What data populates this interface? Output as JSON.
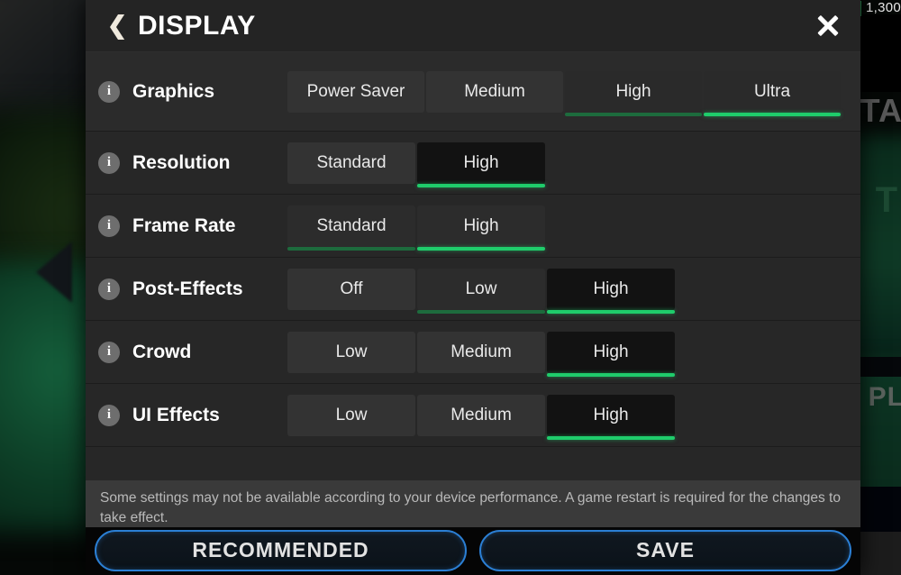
{
  "background": {
    "hud_count": "1,300",
    "text_fragments": [
      "TA",
      "T",
      "PL"
    ]
  },
  "header": {
    "back_icon": "chevron-left-icon",
    "title": "DISPLAY",
    "close_icon": "close-icon"
  },
  "settings": [
    {
      "label": "Graphics",
      "info_icon": "info-icon",
      "options": [
        {
          "label": "Power Saver",
          "state": "unselected"
        },
        {
          "label": "Medium",
          "state": "unselected"
        },
        {
          "label": "High",
          "state": "available"
        },
        {
          "label": "Ultra",
          "state": "selected"
        }
      ]
    },
    {
      "label": "Resolution",
      "info_icon": "info-icon",
      "options": [
        {
          "label": "Standard",
          "state": "unselected"
        },
        {
          "label": "High",
          "state": "selected"
        }
      ]
    },
    {
      "label": "Frame Rate",
      "info_icon": "info-icon",
      "options": [
        {
          "label": "Standard",
          "state": "available"
        },
        {
          "label": "High",
          "state": "selected"
        }
      ]
    },
    {
      "label": "Post-Effects",
      "info_icon": "info-icon",
      "options": [
        {
          "label": "Off",
          "state": "unselected"
        },
        {
          "label": "Low",
          "state": "available"
        },
        {
          "label": "High",
          "state": "selected"
        }
      ]
    },
    {
      "label": "Crowd",
      "info_icon": "info-icon",
      "options": [
        {
          "label": "Low",
          "state": "unselected"
        },
        {
          "label": "Medium",
          "state": "unselected"
        },
        {
          "label": "High",
          "state": "selected"
        }
      ]
    },
    {
      "label": "UI Effects",
      "info_icon": "info-icon",
      "options": [
        {
          "label": "Low",
          "state": "unselected"
        },
        {
          "label": "Medium",
          "state": "unselected"
        },
        {
          "label": "High",
          "state": "selected"
        }
      ]
    }
  ],
  "note": "Some settings may not be available according to your device performance. A game restart is required for the changes to take effect.",
  "footer": {
    "recommended_label": "RECOMMENDED",
    "save_label": "SAVE"
  },
  "colors": {
    "accent_green_bright": "#1fcc6b",
    "accent_green_dim": "#1d6b3d",
    "button_border_blue": "#2b7fd4",
    "panel_bg": "#272727",
    "header_bg": "#242424"
  }
}
